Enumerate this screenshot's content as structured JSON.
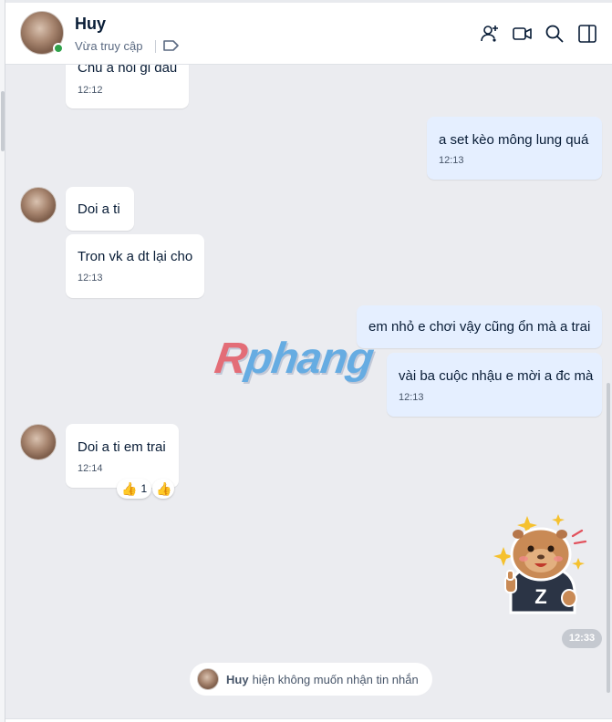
{
  "header": {
    "contact_name": "Huy",
    "status": "Vừa truy cập",
    "icons": [
      "add-member-icon",
      "video-call-icon",
      "search-icon",
      "sidebar-toggle-icon",
      "tag-icon"
    ]
  },
  "messages": [
    {
      "side": "them",
      "text": "Chu a hoi gi dau",
      "time": "12:12"
    },
    {
      "side": "me",
      "text": "a set kèo mông lung quá",
      "time": "12:13"
    },
    {
      "side": "them",
      "text": "Doi a ti",
      "time": ""
    },
    {
      "side": "them",
      "text": "Tron vk a dt lại cho",
      "time": "12:13"
    },
    {
      "side": "me",
      "text": "em nhỏ e chơi vậy cũng ổn mà a trai",
      "time": ""
    },
    {
      "side": "me",
      "text": "vài ba cuộc nhậu e mời a đc mà",
      "time": "12:13"
    },
    {
      "side": "them",
      "text": "Doi a ti em trai",
      "time": "12:14"
    }
  ],
  "reactions": {
    "count": "1",
    "emoji": "👍"
  },
  "sticker": {
    "letter": "Z",
    "time": "12:33"
  },
  "watermark": {
    "first": "R",
    "rest": "phang"
  },
  "notice": {
    "name": "Huy",
    "text": "hiện không muốn nhận tin nhắn"
  },
  "colors": {
    "mine_bubble": "#e5efff",
    "their_bubble": "#ffffff",
    "background": "#ebecf0",
    "online": "#30a24b"
  }
}
